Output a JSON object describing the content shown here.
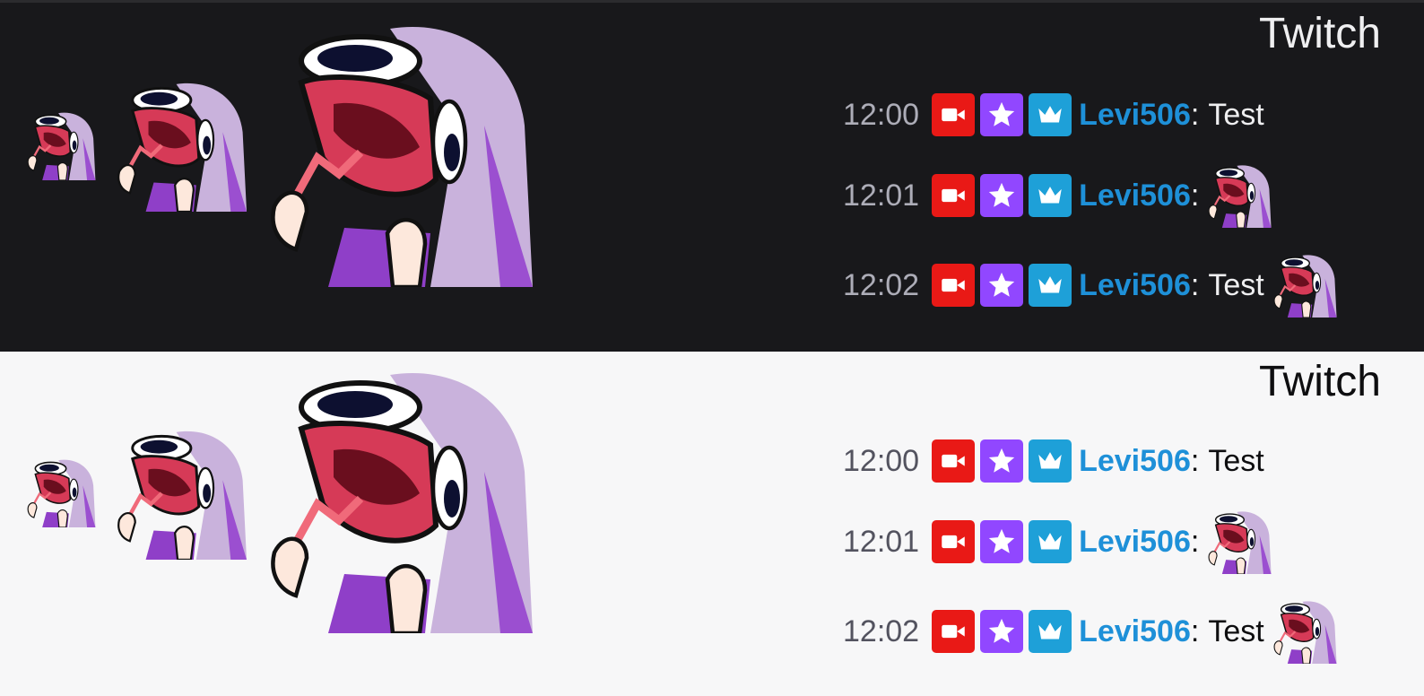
{
  "colors": {
    "dark_bg": "#18181b",
    "light_bg": "#f7f7f8",
    "broadcaster_badge": "#e91916",
    "subscriber_badge": "#9147ff",
    "vip_badge": "#1ea0d8",
    "username": "#1e90d8"
  },
  "emote": {
    "icon": "screaming-anime-girl-emote"
  },
  "panels": [
    {
      "theme": "dark",
      "title": "Twitch",
      "lines": [
        {
          "time": "12:00",
          "user": "Levi506",
          "colon": ":",
          "message": "Test",
          "emote_after": false,
          "badges": [
            "broadcaster-icon",
            "subscriber-star-icon",
            "vip-crown-icon"
          ]
        },
        {
          "time": "12:01",
          "user": "Levi506",
          "colon": ":",
          "message": "",
          "emote_after": true,
          "badges": [
            "broadcaster-icon",
            "subscriber-star-icon",
            "vip-crown-icon"
          ]
        },
        {
          "time": "12:02",
          "user": "Levi506",
          "colon": ":",
          "message": "Test",
          "emote_after": true,
          "badges": [
            "broadcaster-icon",
            "subscriber-star-icon",
            "vip-crown-icon"
          ]
        }
      ]
    },
    {
      "theme": "light",
      "title": "Twitch",
      "lines": [
        {
          "time": "12:00",
          "user": "Levi506",
          "colon": ":",
          "message": "Test",
          "emote_after": false,
          "badges": [
            "broadcaster-icon",
            "subscriber-star-icon",
            "vip-crown-icon"
          ]
        },
        {
          "time": "12:01",
          "user": "Levi506",
          "colon": ":",
          "message": "",
          "emote_after": true,
          "badges": [
            "broadcaster-icon",
            "subscriber-star-icon",
            "vip-crown-icon"
          ]
        },
        {
          "time": "12:02",
          "user": "Levi506",
          "colon": ":",
          "message": "Test",
          "emote_after": true,
          "badges": [
            "broadcaster-icon",
            "subscriber-star-icon",
            "vip-crown-icon"
          ]
        }
      ]
    }
  ]
}
